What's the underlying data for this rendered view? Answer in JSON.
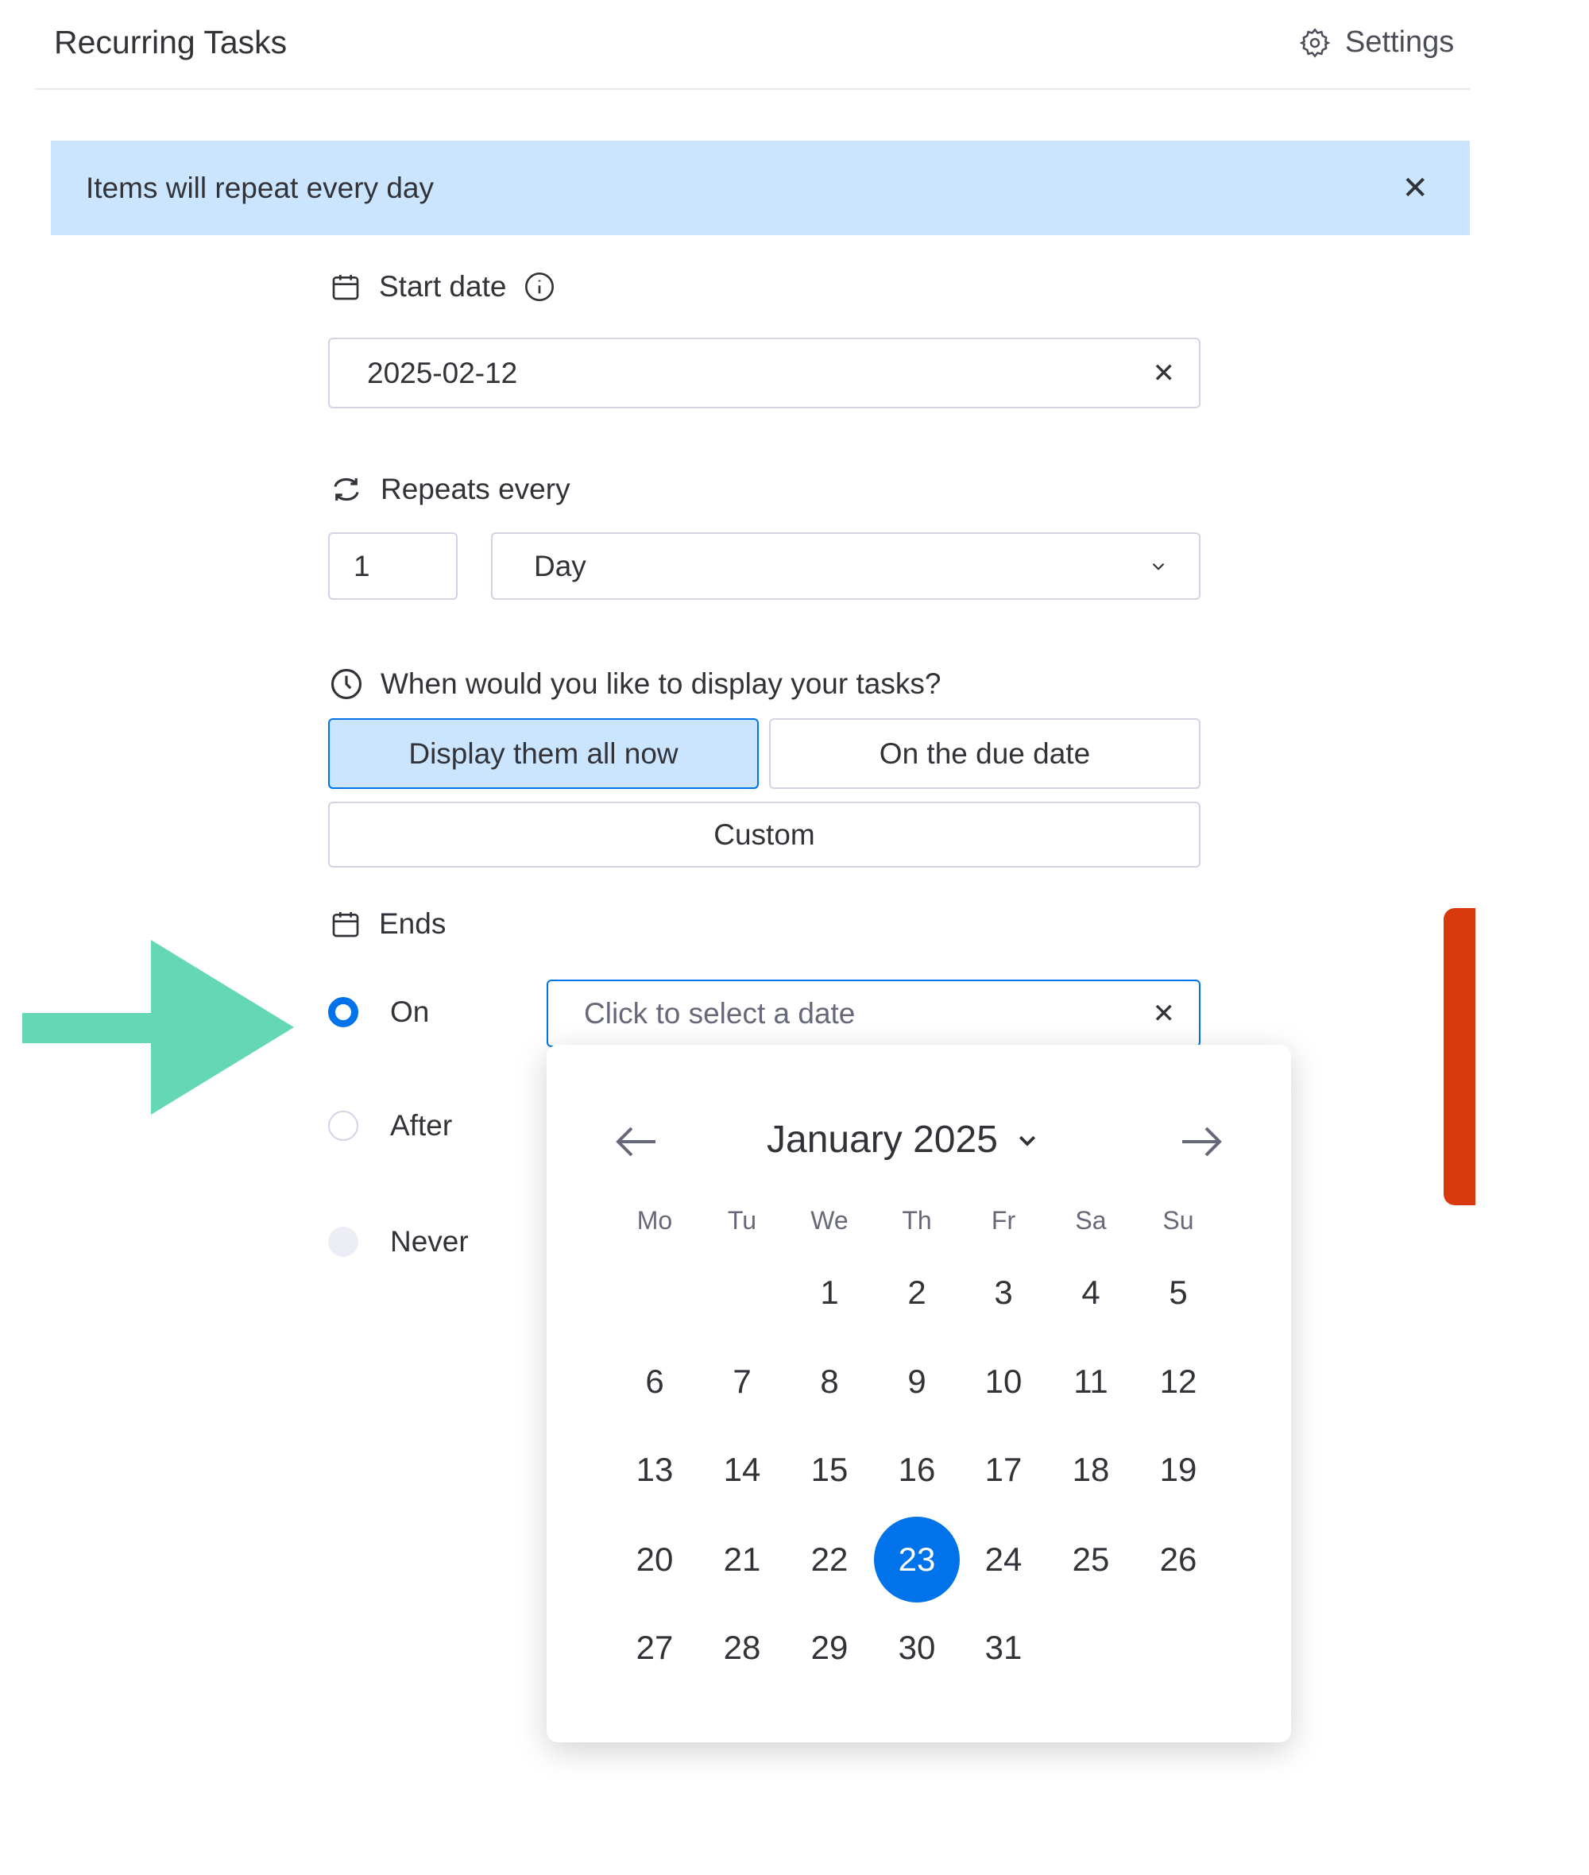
{
  "header": {
    "title": "Recurring Tasks",
    "settings_label": "Settings"
  },
  "banner": {
    "text": "Items will repeat every day",
    "close": "✕"
  },
  "start_date": {
    "label": "Start date",
    "value": "2025-02-12",
    "clear": "✕"
  },
  "repeats": {
    "label": "Repeats every",
    "interval": "1",
    "unit": "Day"
  },
  "display": {
    "question": "When would you like to display your tasks?",
    "options": [
      "Display them all now",
      "On the due date",
      "Custom"
    ],
    "selected": "Display them all now"
  },
  "ends": {
    "label": "Ends",
    "options": [
      "On",
      "After",
      "Never"
    ],
    "selected": "On",
    "date_placeholder": "Click to select a date",
    "clear": "✕"
  },
  "calendar": {
    "month_label": "January 2025",
    "weekdays": [
      "Mo",
      "Tu",
      "We",
      "Th",
      "Fr",
      "Sa",
      "Su"
    ],
    "weeks": [
      [
        "",
        "",
        "1",
        "2",
        "3",
        "4",
        "5"
      ],
      [
        "6",
        "7",
        "8",
        "9",
        "10",
        "11",
        "12"
      ],
      [
        "13",
        "14",
        "15",
        "16",
        "17",
        "18",
        "19"
      ],
      [
        "20",
        "21",
        "22",
        "23",
        "24",
        "25",
        "26"
      ],
      [
        "27",
        "28",
        "29",
        "30",
        "31",
        "",
        ""
      ]
    ],
    "selected_day": "23"
  },
  "colors": {
    "accent": "#0073ea",
    "banner": "#cce5ff",
    "annotation_arrow": "#64d8b4",
    "side_bar": "#d83a0e"
  }
}
